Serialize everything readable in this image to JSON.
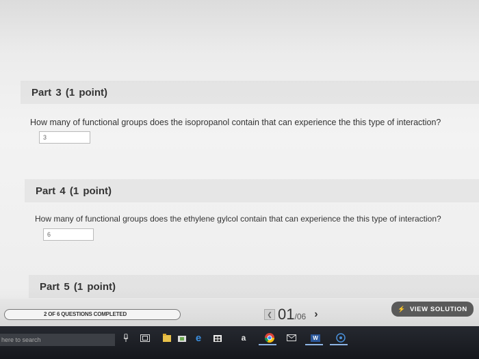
{
  "parts": [
    {
      "title": "Part 3   (1 point)",
      "question": "How many of functional groups does the isopropanol contain that can experience the this type of interaction?",
      "answer": "3"
    },
    {
      "title": "Part 4   (1 point)",
      "question": "How many of functional groups does the ethylene gylcol contain that can experience the this type of interaction?",
      "answer": "6"
    },
    {
      "title": "Part 5   (1 point)"
    }
  ],
  "footer": {
    "progress_text": "2 OF 6 QUESTIONS COMPLETED",
    "page_current": "01",
    "page_separator": "/",
    "page_total": "06",
    "view_solution": "VIEW SOLUTION",
    "view_solution_icon": "lightning-icon"
  },
  "taskbar": {
    "search_placeholder": "here to search",
    "store_letter": "a",
    "word_letter": "W"
  }
}
